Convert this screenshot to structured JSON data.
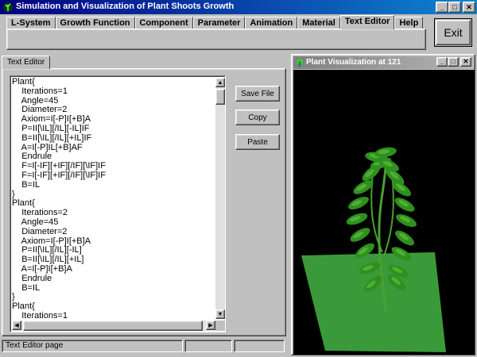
{
  "window": {
    "title": "Simulation and Visualization of Plant Shoots Growth",
    "minimize": "_",
    "maximize": "□",
    "close": "✕"
  },
  "menu_tabs": [
    {
      "label": "L-System"
    },
    {
      "label": "Growth Function"
    },
    {
      "label": "Component"
    },
    {
      "label": "Parameter"
    },
    {
      "label": "Animation"
    },
    {
      "label": "Material"
    },
    {
      "label": "Text Editor",
      "active": true
    },
    {
      "label": "Help"
    }
  ],
  "exit_label": "Exit",
  "editor": {
    "tab_label": "Text Editor",
    "lines": [
      "Plant{",
      "    Iterations=1",
      "    Angle=45",
      "    Diameter=2",
      "    Axiom=I[-P]I[+B]A",
      "    P=II[\\IL][/IL][-IL]IF",
      "    B=II[\\IL][/IL][+IL]IF",
      "    A=I[-P]IL[+B]AF",
      "    Endrule",
      "    F=I[-IF][+IF][/IF][\\IF]IF",
      "    F=I[-IF][+IF][/IF][\\IF]IF",
      "    B=IL",
      "}",
      "Plant{",
      "    Iterations=2",
      "    Angle=45",
      "    Diameter=2",
      "    Axiom=I[-P]I[+B]A",
      "    P=II[\\IL][/IL][-IL]",
      "    B=II[\\IL][/IL][+IL]",
      "    A=I[-P]I[+B]A",
      "    Endrule",
      "    B=IL",
      "}",
      "Plant{",
      "    Iterations=1"
    ],
    "buttons": {
      "save": "Save File",
      "copy": "Copy",
      "paste": "Paste"
    }
  },
  "status": {
    "text": "Text Editor page"
  },
  "visualization": {
    "title": "Plant Visualization at 121",
    "colors": {
      "background": "#000000",
      "ground": "#3a9a3a",
      "leaf": "#2f8f1f",
      "leaf_highlight": "#5ac03a",
      "stem": "#4aa030"
    }
  },
  "colors": {
    "titlebar_active": "#000080",
    "face": "#c0c0c0"
  }
}
